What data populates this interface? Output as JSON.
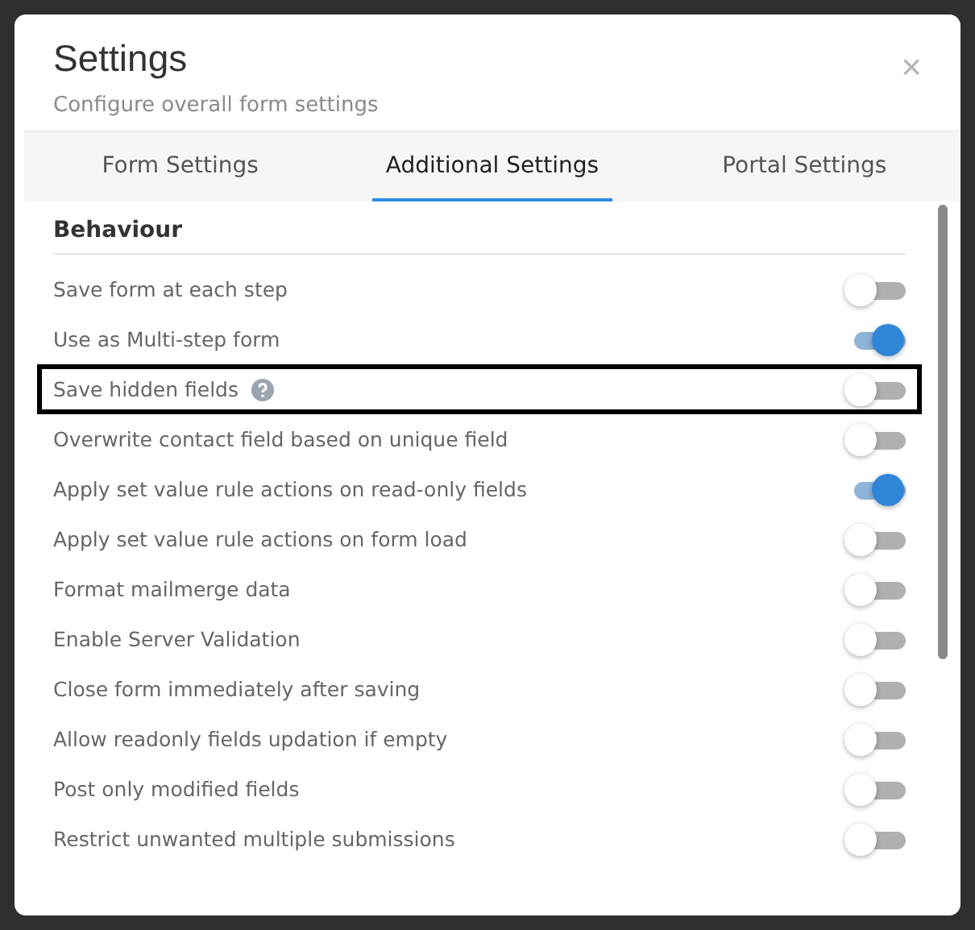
{
  "dialog": {
    "title": "Settings",
    "subtitle": "Configure overall form settings",
    "close": "×"
  },
  "tabs": [
    {
      "label": "Form Settings",
      "selected": false
    },
    {
      "label": "Additional Settings",
      "selected": true
    },
    {
      "label": "Portal Settings",
      "selected": false
    }
  ],
  "section": {
    "title": "Behaviour"
  },
  "settings": [
    {
      "label": "Save form at each step",
      "on": false,
      "highlighted": false,
      "help": false
    },
    {
      "label": "Use as Multi-step form",
      "on": true,
      "highlighted": false,
      "help": false
    },
    {
      "label": "Save hidden fields",
      "on": false,
      "highlighted": true,
      "help": true
    },
    {
      "label": "Overwrite contact field based on unique field",
      "on": false,
      "highlighted": false,
      "help": false
    },
    {
      "label": "Apply set value rule actions on read-only fields",
      "on": true,
      "highlighted": false,
      "help": false
    },
    {
      "label": "Apply set value rule actions on form load",
      "on": false,
      "highlighted": false,
      "help": false
    },
    {
      "label": "Format mailmerge data",
      "on": false,
      "highlighted": false,
      "help": false
    },
    {
      "label": "Enable Server Validation",
      "on": false,
      "highlighted": false,
      "help": false
    },
    {
      "label": "Close form immediately after saving",
      "on": false,
      "highlighted": false,
      "help": false
    },
    {
      "label": "Allow readonly fields updation if empty",
      "on": false,
      "highlighted": false,
      "help": false
    },
    {
      "label": "Post only modified fields",
      "on": false,
      "highlighted": false,
      "help": false
    },
    {
      "label": "Restrict unwanted multiple submissions",
      "on": false,
      "highlighted": false,
      "help": false
    }
  ]
}
